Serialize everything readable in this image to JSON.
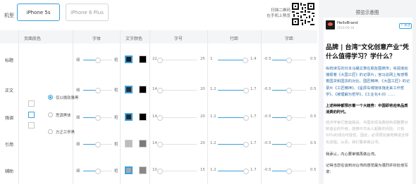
{
  "device": {
    "label": "机型",
    "options": [
      {
        "label": "iPhone 5s",
        "active": true
      },
      {
        "label": "iPhone 6 Plus",
        "active": false
      }
    ],
    "scan_line1": "扫描二维码",
    "scan_line2": "在手机上预览"
  },
  "columns": {
    "page_bg": "页面底色",
    "font": "字体",
    "text_color": "文字颜色",
    "font_size": "字号",
    "line_height": "行距",
    "letter_spacing": "字距"
  },
  "page_bg_swatches": [
    {
      "selected": false
    },
    {
      "selected": true
    },
    {
      "selected": false
    }
  ],
  "font_options": [
    {
      "label": "仅以微软雅黑",
      "checked": true
    },
    {
      "label": "思源黑体",
      "checked": false
    },
    {
      "label": "方正兰亭黑",
      "checked": false
    }
  ],
  "rows": [
    {
      "label": "标题",
      "weight": {
        "min": "细",
        "max": "粗",
        "value": 0.5
      },
      "colors": [
        {
          "hex": "#1f1f1f",
          "selected": true
        },
        {
          "hex": "#000000",
          "selected": false
        }
      ],
      "size": {
        "min": "22",
        "max": "25",
        "value": 0.0
      },
      "leading": {
        "min": "1",
        "max": "1.4",
        "value": 0.88
      },
      "tracking": {
        "min": "-0.5",
        "max": "0.5",
        "value": 0.5
      }
    },
    {
      "label": "正文",
      "weight": {
        "min": "细",
        "max": "粗",
        "value": 0.5
      },
      "colors": [
        {
          "hex": "#2d2d2d",
          "selected": true
        },
        {
          "hex": "#000000",
          "selected": false
        }
      ],
      "size": {
        "min": "14",
        "max": "20",
        "value": 0.0
      },
      "leading": {
        "min": "1.2",
        "max": "1.7",
        "value": 0.92
      },
      "tracking": {
        "min": "-0.5",
        "max": "0.5",
        "value": 0.5
      }
    },
    {
      "label": "强调",
      "weight": {
        "min": "细",
        "max": "粗",
        "value": 0.5
      },
      "colors": [
        {
          "hex": "#2a2a2a",
          "selected": true
        },
        {
          "hex": "#000000",
          "selected": false
        }
      ],
      "size": {
        "min": "14",
        "max": "20",
        "value": 0.0
      },
      "leading": {
        "min": "1.2",
        "max": "1.7",
        "value": 0.92
      },
      "tracking": {
        "min": "-0.5",
        "max": "0.5",
        "value": 0.5
      }
    },
    {
      "label": "引用",
      "weight": {
        "min": "细",
        "max": "粗",
        "value": 0.5
      },
      "colors": [
        {
          "hex": "#bdbdbd",
          "selected": false
        },
        {
          "hex": "#7a7a7a",
          "selected": false
        }
      ],
      "size": {
        "min": "14",
        "max": "20",
        "value": 0.0
      },
      "leading": {
        "min": "1.2",
        "max": "1.7",
        "value": 0.92
      },
      "tracking": {
        "min": "-0.5",
        "max": "0.5",
        "value": 0.5
      }
    },
    {
      "label": "辅助",
      "weight": {
        "min": "细",
        "max": "粗",
        "value": 0.5
      },
      "colors": [
        {
          "hex": "#a8a8a8",
          "selected": true
        },
        {
          "hex": "#888888",
          "selected": false
        }
      ],
      "size": {
        "min": "10",
        "max": "15",
        "value": 0.0
      },
      "leading": {
        "min": "1.2",
        "max": "1.7",
        "value": 0.92
      },
      "tracking": {
        "min": "-0.5",
        "max": "0.5",
        "value": 0.5
      }
    }
  ],
  "preview": {
    "title": "预览示意图",
    "brand": "HelloBrand",
    "date": "2016-06-16",
    "follow": "+ 关注",
    "article_title": "品牌 | 台湾\"文化创意产业\"凭什么值得学习？学什么？",
    "p1": "纵统读写的日本马桶文章在朋友圈疯传；央视滚动播报着《大国工匠》的记录片；官马总网上有感慨着国货和国货的对比、国匠精神、《大国工匠》的记录片《工匠精神》、《星辰车博馆体馆走来工作哲学》、《被理解为哲学》、《工业化4.0》……",
    "p2": "上述种种都预示着一个大趋势：中国即将迎来品质消费的时代。",
    "p3": "经济学家们普遍假设、中国实现消费结构调整要对制造业的升级，能够中华会人起跑的风险，只有50%的成功可能性。因此，必须再加速地推进全球化进程。从而，我们看来做台湾。",
    "p4": "我承认，内心要审慎再做台湾。",
    "p5": "记得当您在谈到对台湾的感觉最为强烈并好处他写道："
  }
}
